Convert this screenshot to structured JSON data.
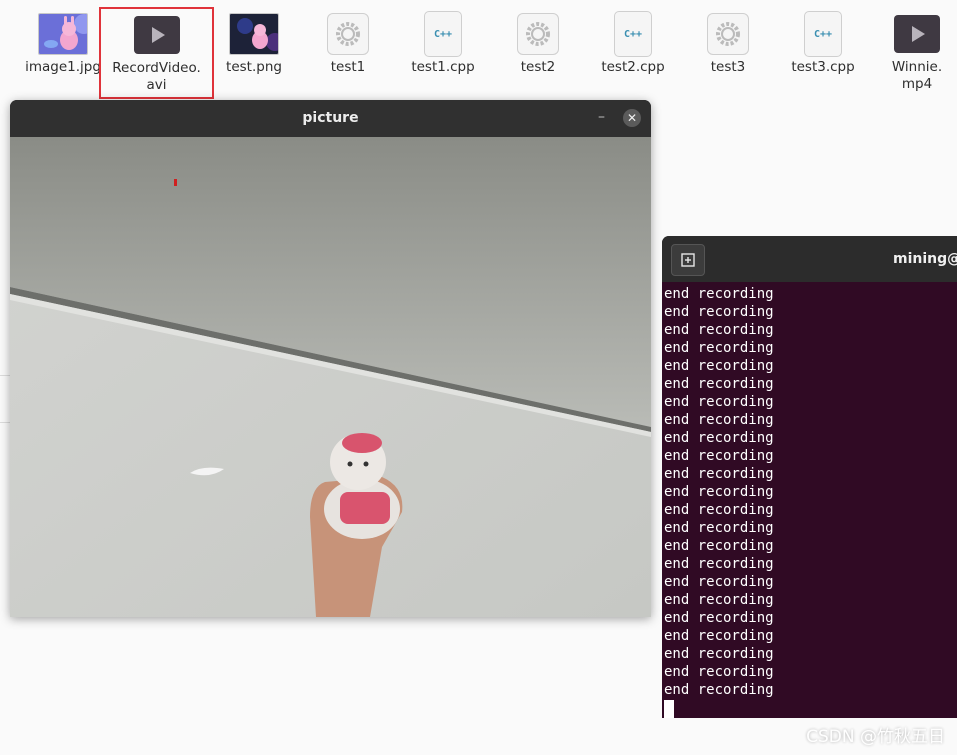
{
  "files": [
    {
      "name": "image1.jpg",
      "icon": "image-thumbnail-icon"
    },
    {
      "name": "RecordVideo.avi",
      "icon": "video-file-icon",
      "selected": true
    },
    {
      "name": "test.png",
      "icon": "image-thumbnail-icon"
    },
    {
      "name": "test1",
      "icon": "executable-gear-icon"
    },
    {
      "name": "test1.cpp",
      "icon": "cpp-file-icon",
      "badge": "C++"
    },
    {
      "name": "test2",
      "icon": "executable-gear-icon"
    },
    {
      "name": "test2.cpp",
      "icon": "cpp-file-icon",
      "badge": "C++"
    },
    {
      "name": "test3",
      "icon": "executable-gear-icon"
    },
    {
      "name": "test3.cpp",
      "icon": "cpp-file-icon",
      "badge": "C++"
    },
    {
      "name": "Winnie.mp4",
      "icon": "video-file-icon"
    }
  ],
  "picture_window": {
    "title": "picture",
    "minimize_glyph": "–",
    "close_glyph": "✕"
  },
  "terminal": {
    "title": "mining@u",
    "new_tab_icon": "new-tab-icon",
    "lines": [
      "end recording",
      "end recording",
      "end recording",
      "end recording",
      "end recording",
      "end recording",
      "end recording",
      "end recording",
      "end recording",
      "end recording",
      "end recording",
      "end recording",
      "end recording",
      "end recording",
      "end recording",
      "end recording",
      "end recording",
      "end recording",
      "end recording",
      "end recording",
      "end recording",
      "end recording",
      "end recording"
    ]
  },
  "watermark": "CSDN @竹秋五日",
  "colors": {
    "selection_border": "#e0333a",
    "terminal_bg": "#300a24",
    "titlebar": "#303030"
  }
}
